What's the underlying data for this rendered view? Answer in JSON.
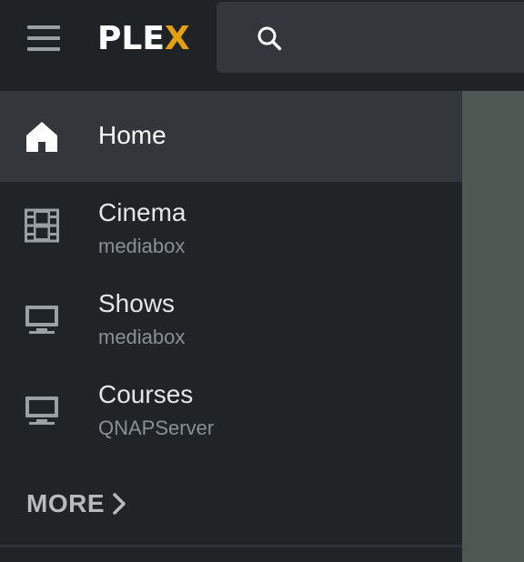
{
  "app": {
    "logo_text_main": "PLE",
    "logo_text_accent": "X",
    "accent_color": "#e5a00d"
  },
  "sidebar": {
    "items": [
      {
        "title": "Home",
        "subtitle": "",
        "icon": "home-icon",
        "active": true
      },
      {
        "title": "Cinema",
        "subtitle": "mediabox",
        "icon": "film-icon",
        "active": false
      },
      {
        "title": "Shows",
        "subtitle": "mediabox",
        "icon": "monitor-icon",
        "active": false
      },
      {
        "title": "Courses",
        "subtitle": "QNAPServer",
        "icon": "monitor-icon",
        "active": false
      }
    ],
    "more_label": "MORE"
  }
}
